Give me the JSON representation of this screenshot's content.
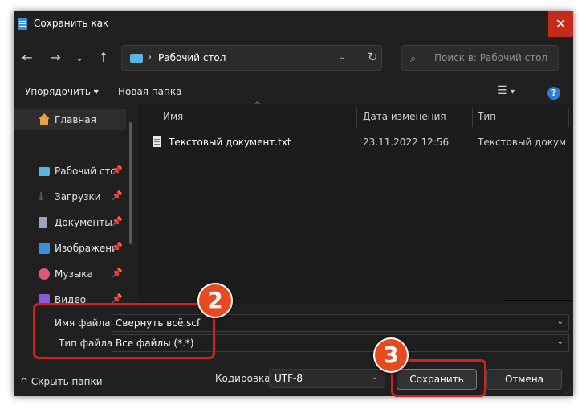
{
  "window": {
    "title": "Сохранить как",
    "close": "✕"
  },
  "nav": {
    "back": "←",
    "forward": "→",
    "recent": "⌄",
    "up": "↑",
    "address_path": "Рабочий стол",
    "address_sep": "›",
    "address_dd": "⌄",
    "refresh": "↻",
    "search_placeholder": "Поиск в: Рабочий стол",
    "search_icon": "⌕"
  },
  "toolbar": {
    "organize": "Упорядочить",
    "organize_caret": "▾",
    "new_folder": "Новая папка",
    "view_icon": "☰",
    "view_caret": "▾",
    "help": "?"
  },
  "sidebar": {
    "items": [
      {
        "label": "Главная",
        "icon": "home-icon",
        "pinned": false
      },
      {
        "label": "Рабочий стол",
        "icon": "desktop-icon",
        "pinned": true
      },
      {
        "label": "Загрузки",
        "icon": "downloads-icon",
        "pinned": true
      },
      {
        "label": "Документы",
        "icon": "documents-icon",
        "pinned": true
      },
      {
        "label": "Изображения",
        "icon": "pictures-icon",
        "pinned": true
      },
      {
        "label": "Музыка",
        "icon": "music-icon",
        "pinned": true
      },
      {
        "label": "Видео",
        "icon": "videos-icon",
        "pinned": true
      }
    ],
    "pin_glyph": "📌"
  },
  "columns": {
    "name": "Имя",
    "date": "Дата изменения",
    "type": "Тип",
    "sort_arrow": "^"
  },
  "files": [
    {
      "name": "Текстовый документ.txt",
      "date": "23.11.2022 12:56",
      "type": "Текстовый докум..."
    }
  ],
  "form": {
    "filename_label": "Имя файла:",
    "filename_value": "Свернуть всё.scf",
    "filetype_label": "Тип файла:",
    "filetype_value": "Все файлы  (*.*)",
    "dd": "⌄",
    "hide_folders": "Скрыть папки",
    "hide_caret": "^",
    "encoding_label": "Кодировка:",
    "encoding_value": "UTF-8",
    "save": "Сохранить",
    "cancel": "Отмена"
  },
  "annotations": {
    "badge2": "2",
    "badge3": "3",
    "color": "#d81f1f",
    "badge_color": "#e64a1e"
  }
}
